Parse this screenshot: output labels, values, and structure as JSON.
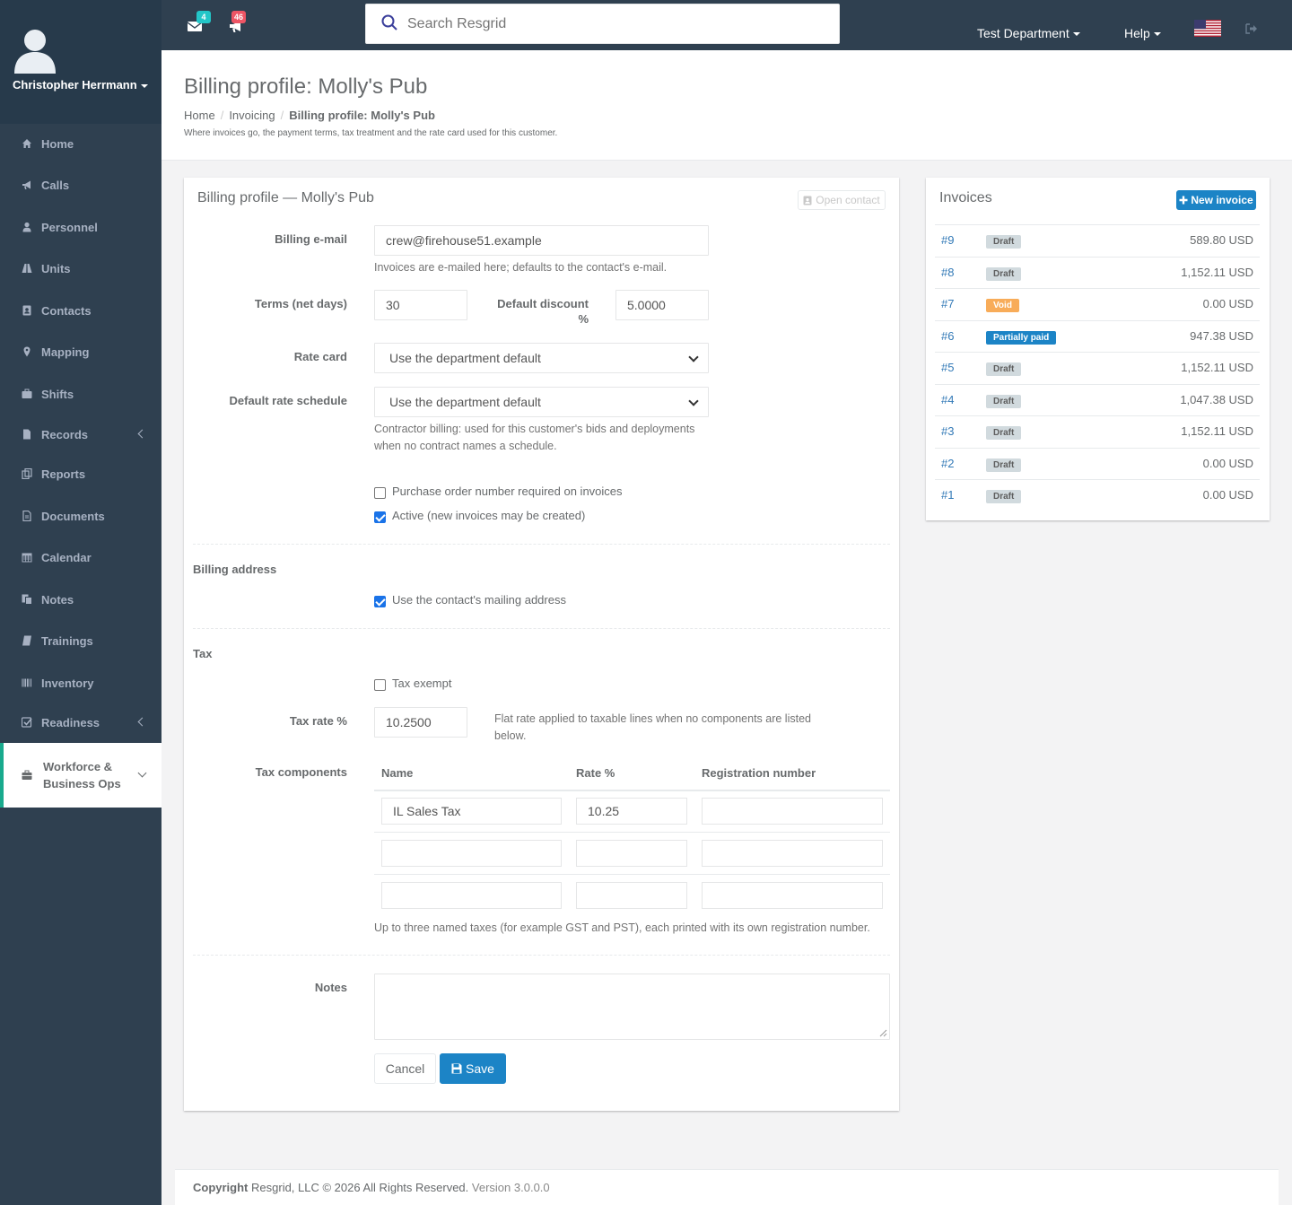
{
  "user": {
    "name": "Christopher Herrmann"
  },
  "topbar": {
    "mail_count": "4",
    "notif_count": "46",
    "search_placeholder": "Search Resgrid",
    "department": "Test Department",
    "help": "Help"
  },
  "nav": [
    {
      "label": "Home",
      "icon": "home-icon"
    },
    {
      "label": "Calls",
      "icon": "bullhorn-icon"
    },
    {
      "label": "Personnel",
      "icon": "user-icon"
    },
    {
      "label": "Units",
      "icon": "road-icon"
    },
    {
      "label": "Contacts",
      "icon": "address-book-icon"
    },
    {
      "label": "Mapping",
      "icon": "map-marker-icon"
    },
    {
      "label": "Shifts",
      "icon": "briefcase-icon"
    },
    {
      "label": "Records",
      "icon": "file-icon"
    },
    {
      "label": "Reports",
      "icon": "reports-icon"
    },
    {
      "label": "Documents",
      "icon": "document-icon"
    },
    {
      "label": "Calendar",
      "icon": "calendar-icon"
    },
    {
      "label": "Notes",
      "icon": "notes-icon"
    },
    {
      "label": "Trainings",
      "icon": "book-icon"
    },
    {
      "label": "Inventory",
      "icon": "barcode-icon"
    },
    {
      "label": "Readiness",
      "icon": "check-square-icon"
    },
    {
      "label": "Workforce & Business Ops",
      "icon": "briefcase-icon"
    }
  ],
  "page": {
    "title": "Billing profile: Molly's Pub",
    "breadcrumb": [
      "Home",
      "Invoicing",
      "Billing profile: Molly's Pub"
    ],
    "description": "Where invoices go, the payment terms, tax treatment and the rate card used for this customer."
  },
  "form": {
    "title": "Billing profile — Molly's Pub",
    "open_contact": "Open contact",
    "billing_email_label": "Billing e-mail",
    "billing_email_value": "crew@firehouse51.example",
    "billing_email_help": "Invoices are e-mailed here; defaults to the contact's e-mail.",
    "terms_label": "Terms (net days)",
    "terms_value": "30",
    "discount_label_1": "Default discount",
    "discount_label_2": "%",
    "discount_value": "5.0000",
    "rate_card_label": "Rate card",
    "rate_card_value": "Use the department default",
    "rate_schedule_label": "Default rate schedule",
    "rate_schedule_value": "Use the department default",
    "rate_schedule_help_1": "Contractor billing: used for this customer's bids and deployments",
    "rate_schedule_help_2": "when no contract names a schedule.",
    "po_required_label": "Purchase order number required on invoices",
    "po_required": false,
    "active_label": "Active (new invoices may be created)",
    "active": true,
    "billing_address_heading": "Billing address",
    "use_mailing_label": "Use the contact's mailing address",
    "use_mailing": true,
    "tax_heading": "Tax",
    "tax_exempt_label": "Tax exempt",
    "tax_exempt": false,
    "tax_rate_label": "Tax rate %",
    "tax_rate_value": "10.2500",
    "tax_rate_help_1": "Flat rate applied to taxable lines when no components are listed",
    "tax_rate_help_2": "below.",
    "tax_components_label": "Tax components",
    "tax_columns": [
      "Name",
      "Rate %",
      "Registration number"
    ],
    "tax_components": [
      {
        "name": "IL Sales Tax",
        "rate": "10.25",
        "registration": ""
      },
      {
        "name": "",
        "rate": "",
        "registration": ""
      },
      {
        "name": "",
        "rate": "",
        "registration": ""
      }
    ],
    "tax_components_help": "Up to three named taxes (for example GST and PST), each printed with its own registration number.",
    "notes_label": "Notes",
    "notes_value": "",
    "cancel": "Cancel",
    "save": "Save"
  },
  "invoices": {
    "title": "Invoices",
    "new_button": "New invoice",
    "items": [
      {
        "number": "#9",
        "status": "Draft",
        "amount": "589.80 USD"
      },
      {
        "number": "#8",
        "status": "Draft",
        "amount": "1,152.11 USD"
      },
      {
        "number": "#7",
        "status": "Void",
        "amount": "0.00 USD"
      },
      {
        "number": "#6",
        "status": "Partially paid",
        "amount": "947.38 USD"
      },
      {
        "number": "#5",
        "status": "Draft",
        "amount": "1,152.11 USD"
      },
      {
        "number": "#4",
        "status": "Draft",
        "amount": "1,047.38 USD"
      },
      {
        "number": "#3",
        "status": "Draft",
        "amount": "1,152.11 USD"
      },
      {
        "number": "#2",
        "status": "Draft",
        "amount": "0.00 USD"
      },
      {
        "number": "#1",
        "status": "Draft",
        "amount": "0.00 USD"
      }
    ]
  },
  "colors": {
    "sidebar": "#2f4050",
    "accent": "#1c84c6",
    "draft_badge": "#d1dade",
    "void_badge": "#f8ac59",
    "partial_badge": "#1c84c6"
  },
  "footer": {
    "copyright_bold": "Copyright",
    "copyright": "Resgrid, LLC © 2026 All Rights Reserved.",
    "version": "Version 3.0.0.0"
  }
}
